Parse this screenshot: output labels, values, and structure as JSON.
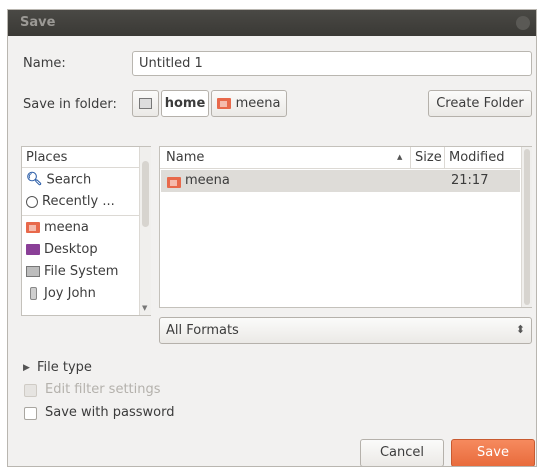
{
  "window": {
    "title": "Save"
  },
  "name_row": {
    "label": "Name:",
    "value": "Untitled 1"
  },
  "folder_row": {
    "label": "Save in folder:",
    "crumbs": [
      {
        "label": "home"
      },
      {
        "label": "meena"
      }
    ],
    "create_folder_label": "Create Folder"
  },
  "places": {
    "header": "Places",
    "items": [
      {
        "label": "Search",
        "icon": "search-icon"
      },
      {
        "label": "Recently ...",
        "icon": "recent-icon"
      },
      {
        "label": "meena",
        "icon": "home-folder-icon"
      },
      {
        "label": "Desktop",
        "icon": "desktop-icon"
      },
      {
        "label": "File System",
        "icon": "drive-icon"
      },
      {
        "label": "Joy John",
        "icon": "usb-drive-icon"
      }
    ]
  },
  "files": {
    "columns": {
      "name": "Name",
      "size": "Size",
      "modified": "Modified"
    },
    "sort_indicator": "▲",
    "rows": [
      {
        "name": "meena",
        "size": "",
        "modified": "21:17",
        "icon": "folder-icon"
      }
    ]
  },
  "filter": {
    "selected": "All Formats",
    "arrows": "⬍"
  },
  "file_type": {
    "label": "File type",
    "expander": "▶"
  },
  "options": {
    "edit_filter": "Edit filter settings",
    "save_password": "Save with password"
  },
  "buttons": {
    "cancel": "Cancel",
    "save": "Save"
  },
  "colors": {
    "accent": "#f07746",
    "folder": "#e8694b"
  }
}
